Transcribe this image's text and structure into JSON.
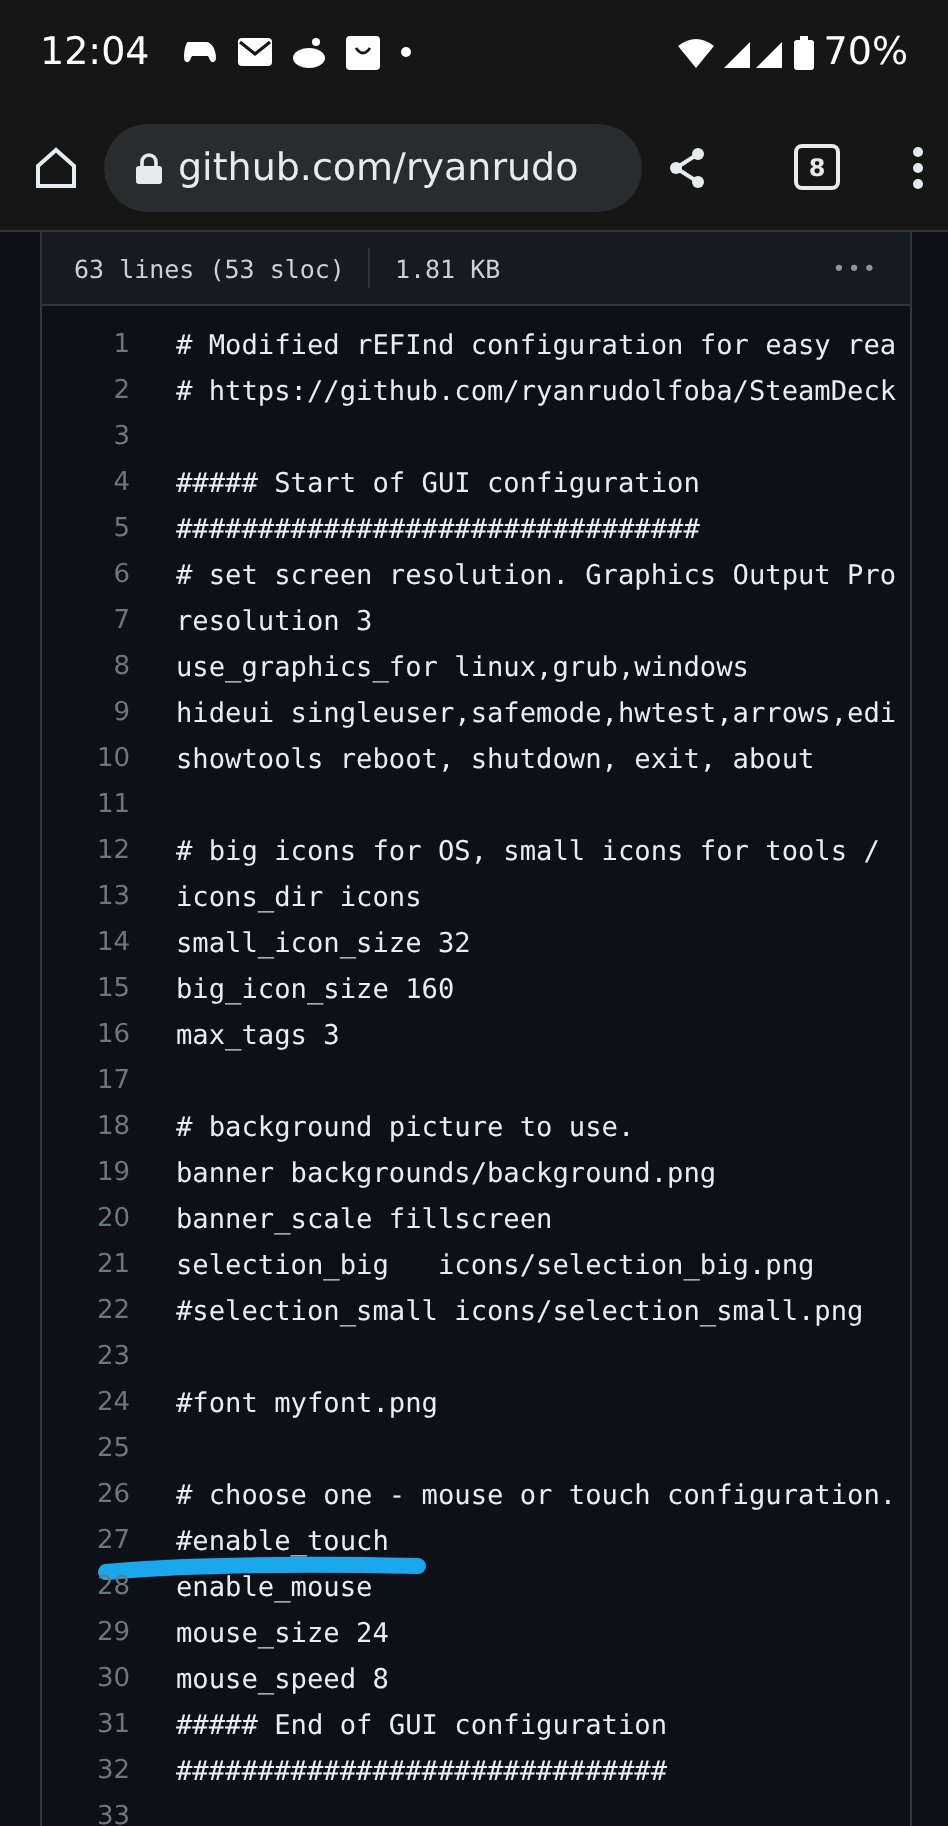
{
  "status_bar": {
    "time": "12:04",
    "battery": "70%"
  },
  "browser": {
    "url": "github.com/ryanrudo",
    "tab_count": "8"
  },
  "file_header": {
    "lines": "63 lines (53 sloc)",
    "size": "1.81 KB",
    "menu": "•••"
  },
  "code": {
    "lines": [
      {
        "number": "1",
        "text": "# Modified rEFInd configuration for easy rea"
      },
      {
        "number": "2",
        "text": "# https://github.com/ryanrudolfoba/SteamDeck"
      },
      {
        "number": "3"
      },
      {
        "number": "4",
        "text": "##### Start of GUI configuration"
      },
      {
        "number": "5",
        "text": "################################"
      },
      {
        "number": "6",
        "text": "# set screen resolution. Graphics Output Pro"
      },
      {
        "number": "7",
        "text": "resolution 3"
      },
      {
        "number": "8",
        "text": "use_graphics_for linux,grub,windows"
      },
      {
        "number": "9",
        "text": "hideui singleuser,safemode,hwtest,arrows,edi"
      },
      {
        "number": "10",
        "text": "showtools reboot, shutdown, exit, about"
      },
      {
        "number": "11"
      },
      {
        "number": "12",
        "text": "# big icons for OS, small icons for tools /"
      },
      {
        "number": "13",
        "text": "icons_dir icons"
      },
      {
        "number": "14",
        "text": "small_icon_size 32"
      },
      {
        "number": "15",
        "text": "big_icon_size 160"
      },
      {
        "number": "16",
        "text": "max_tags 3"
      },
      {
        "number": "17"
      },
      {
        "number": "18",
        "text": "# background picture to use."
      },
      {
        "number": "19",
        "text": "banner backgrounds/background.png"
      },
      {
        "number": "20",
        "text": "banner_scale fillscreen"
      },
      {
        "number": "21",
        "text": "selection_big   icons/selection_big.png"
      },
      {
        "number": "22",
        "text": "#selection_small icons/selection_small.png"
      },
      {
        "number": "23"
      },
      {
        "number": "24",
        "text": "#font myfont.png"
      },
      {
        "number": "25"
      },
      {
        "number": "26",
        "text": "# choose one - mouse or touch configuration."
      },
      {
        "number": "27",
        "text": "#enable_touch",
        "underlined": true
      },
      {
        "number": "28",
        "text": "enable_mouse"
      },
      {
        "number": "29",
        "text": "mouse_size 24"
      },
      {
        "number": "30",
        "text": "mouse_speed 8"
      },
      {
        "number": "31",
        "text": "##### End of GUI configuration"
      },
      {
        "number": "32",
        "text": "##############################"
      },
      {
        "number": "33"
      }
    ]
  }
}
